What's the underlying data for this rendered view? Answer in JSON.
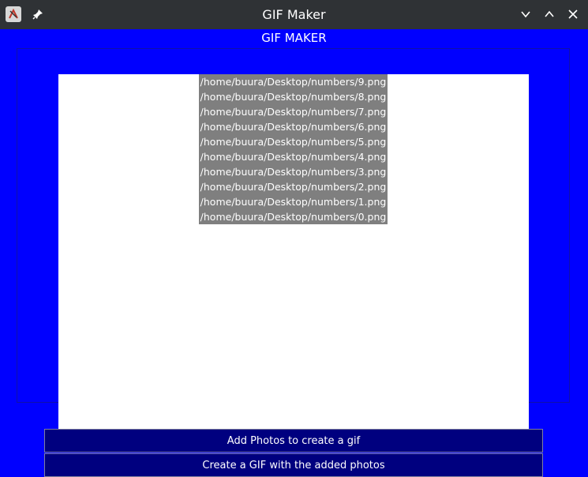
{
  "window": {
    "title": "GIF Maker",
    "icons": {
      "app": "app-icon",
      "pin": "pin-icon",
      "minimize": "chevron-down-icon",
      "maximize": "chevron-up-icon",
      "close": "close-icon"
    }
  },
  "header": {
    "title": "GIF MAKER"
  },
  "photo_list": {
    "items": [
      "/home/buura/Desktop/numbers/9.png",
      "/home/buura/Desktop/numbers/8.png",
      "/home/buura/Desktop/numbers/7.png",
      "/home/buura/Desktop/numbers/6.png",
      "/home/buura/Desktop/numbers/5.png",
      "/home/buura/Desktop/numbers/4.png",
      "/home/buura/Desktop/numbers/3.png",
      "/home/buura/Desktop/numbers/2.png",
      "/home/buura/Desktop/numbers/1.png",
      "/home/buura/Desktop/numbers/0.png"
    ]
  },
  "buttons": {
    "add_photos": "Add Photos to create a gif",
    "create_gif": "Create a GIF with the added photos"
  },
  "colors": {
    "background": "#0000ff",
    "titlebar": "#2f3235",
    "button": "#00007f",
    "selection": "#7f7f7f"
  }
}
